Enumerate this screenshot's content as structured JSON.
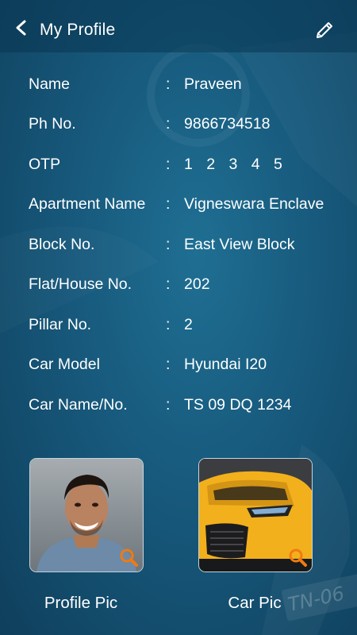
{
  "header": {
    "title": "My Profile",
    "back_icon": "chevron-left-icon",
    "edit_icon": "pencil-icon"
  },
  "profile": {
    "separator": ":",
    "rows": [
      {
        "label": "Name",
        "value": "Praveen"
      },
      {
        "label": "Ph No.",
        "value": "9866734518"
      },
      {
        "label": "OTP",
        "value": "1 2 3 4 5"
      },
      {
        "label": "Apartment Name",
        "value": "Vigneswara Enclave"
      },
      {
        "label": "Block No.",
        "value": "East View Block"
      },
      {
        "label": "Flat/House No.",
        "value": "202"
      },
      {
        "label": "Pillar No.",
        "value": "2"
      },
      {
        "label": "Car Model",
        "value": "Hyundai I20"
      },
      {
        "label": "Car Name/No.",
        "value": "TS 09 DQ 1234"
      }
    ]
  },
  "pictures": {
    "profile_label": "Profile Pic",
    "car_label": "Car Pic",
    "zoom_icon": "magnifier-icon"
  },
  "background": {
    "plate_text": "TN-06"
  },
  "colors": {
    "background": "#17597c",
    "header": "#0f4565",
    "accent_zoom": "#f07a12",
    "car_yellow": "#f2b01c"
  }
}
